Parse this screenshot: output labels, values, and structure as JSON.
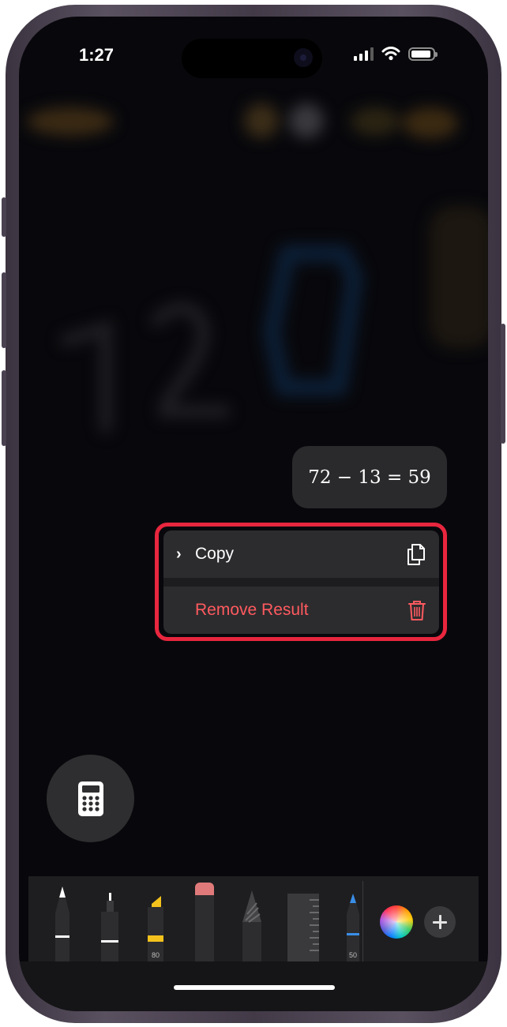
{
  "status_bar": {
    "time": "1:27"
  },
  "result": {
    "expression": "72 − 13 = 59"
  },
  "context_menu": {
    "items": [
      {
        "label": "Copy",
        "icon": "copy-icon",
        "color": "#ffffff"
      },
      {
        "label": "Remove Result",
        "icon": "trash-icon",
        "color": "#ff5a5f"
      }
    ],
    "highlight_color": "#e8263e"
  },
  "toolbar": {
    "tools": [
      {
        "name": "pen",
        "label": ""
      },
      {
        "name": "monoline",
        "label": ""
      },
      {
        "name": "highlighter",
        "label": "80"
      },
      {
        "name": "eraser",
        "label": ""
      },
      {
        "name": "pencil",
        "label": ""
      },
      {
        "name": "ruler",
        "label": ""
      },
      {
        "name": "crayon-blue",
        "label": "50"
      }
    ]
  },
  "icons": {
    "calculator": "calculator-icon",
    "color_picker": "color-wheel-icon",
    "add": "plus-icon"
  }
}
